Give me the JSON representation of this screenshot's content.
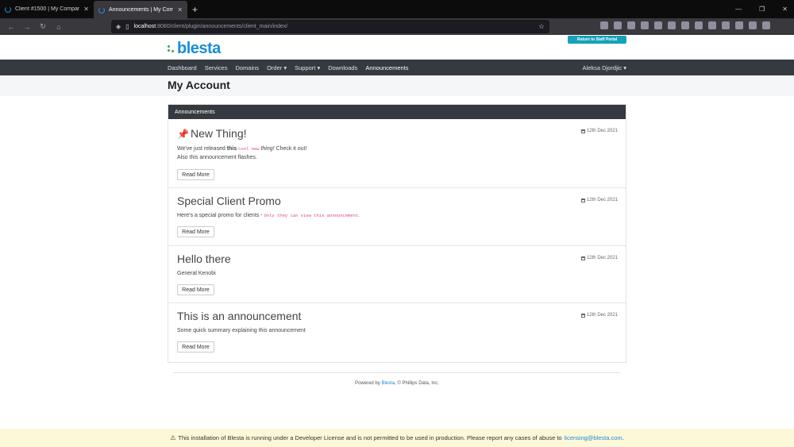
{
  "browser": {
    "tabs": [
      {
        "title": "Client #1500 | My Company",
        "active": false
      },
      {
        "title": "Announcements | My Company",
        "active": true
      }
    ],
    "new_tab_label": "+",
    "url_host": "localhost",
    "url_rest": ":8080/client/plugin/announcements/client_main/index/",
    "window_controls": [
      "—",
      "❐",
      "✕"
    ]
  },
  "site": {
    "logo_text": "blesta",
    "staff_portal_label": "Return to Staff Portal",
    "nav": [
      "Dashboard",
      "Services",
      "Domains",
      "Order ▾",
      "Support ▾",
      "Downloads",
      "Announcements"
    ],
    "user_name": "Aleksa Djordjic ▾",
    "page_title": "My Account"
  },
  "panel": {
    "heading": "Announcements",
    "items": [
      {
        "title": "New Thing!",
        "pinned": true,
        "date": "12th Dec 2021",
        "summary": {
          "line1_pre": "We've just released ",
          "line1_bold": "this",
          "line1_code": "cool new",
          "line1_italic": "thing!",
          "line1_post": " Check it out!",
          "line2": "Also this announcement flashes."
        },
        "button": "Read More"
      },
      {
        "title": "Special Client Promo",
        "date": "12th Dec 2021",
        "summary_pre": "Here's a special promo for clients - ",
        "summary_code": "Only they can view this announcement.",
        "button": "Read More"
      },
      {
        "title": "Hello there",
        "date": "12th Dec 2021",
        "summary": "General Kenobi",
        "button": "Read More"
      },
      {
        "title": "This is an announcement",
        "date": "12th Dec 2021",
        "summary": "Some quick summary explaining this announcement",
        "button": "Read More"
      }
    ]
  },
  "footer": {
    "powered_pre": "Powered by ",
    "powered_link": "Blesta",
    "powered_post": ", © Phillips Data, Inc."
  },
  "dev_notice": {
    "text": "This installation of Blesta is running under a Developer License and is not permitted to be used in production. Please report any cases of abuse to",
    "email": "licensing@blesta.com",
    "end": "."
  },
  "colors": {
    "accent": "#1a8cd8",
    "nav_bg": "#343a40",
    "staff_button": "#17a2b8",
    "notice_bg": "#fdf8d8"
  }
}
